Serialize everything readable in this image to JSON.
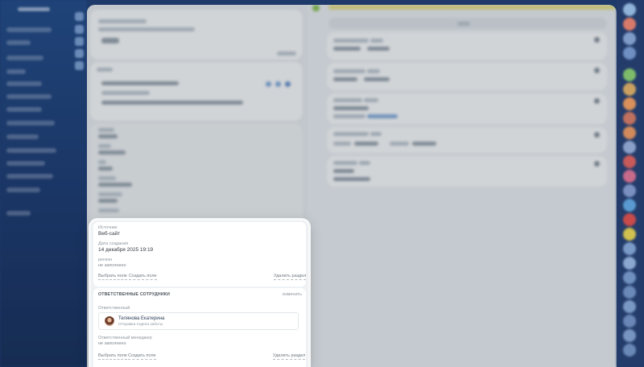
{
  "source_section": {
    "source_label": "Источник",
    "source_value": "Веб-сайт",
    "created_label": "Дата создания",
    "created_value": "14 декабря 2025 19:19",
    "region_label": "регион",
    "region_value": "не заполнено",
    "choose_field": "Выбрать поле",
    "create_field": "Создать поле",
    "delete_section": "Удалить раздел"
  },
  "responsible_section": {
    "title": "ОТВЕТСТВЕННЫЕ СОТРУДНИКИ",
    "edit": "изменить",
    "responsible_label": "Ответственный",
    "person_name": "Телянова Екатерина",
    "person_position": "Отправка отдела заботы",
    "manager_label": "Ответственный менеджер",
    "manager_value": "не заполнено",
    "choose_field": "Выбрать поле",
    "create_field": "Создать поле",
    "delete_section": "Удалить раздел"
  },
  "colors": {
    "nav_bg": "#1f4378",
    "panel_bg": "#eef2f4",
    "accent_yellow": "#e8e07a",
    "accent_green": "#7fbf3f"
  }
}
